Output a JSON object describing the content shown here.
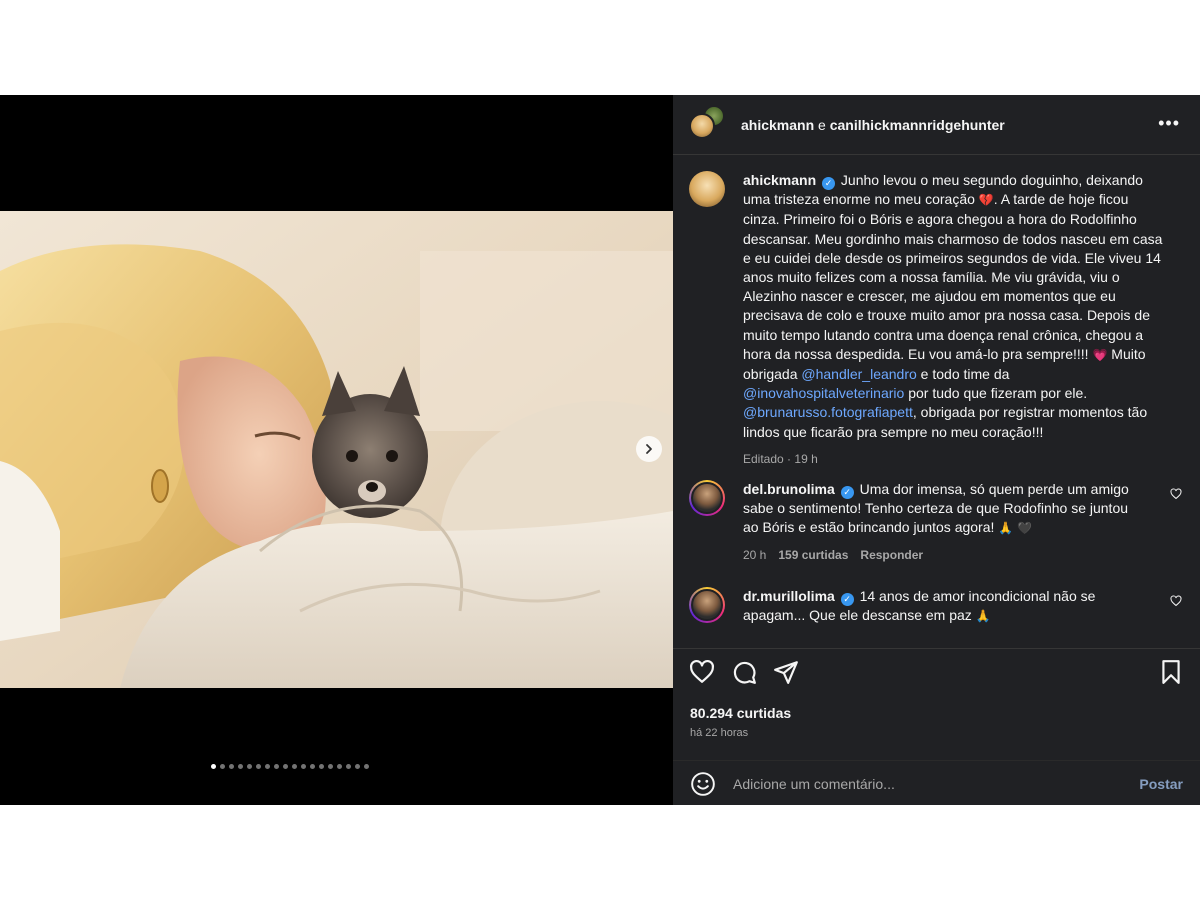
{
  "header": {
    "user1": "ahickmann",
    "conjunction": "e",
    "user2": "canilhickmannridgehunter",
    "more_label": "•••"
  },
  "caption": {
    "username": "ahickmann",
    "verified_mark": "✓",
    "part1": "Junho levou o meu segundo doguinho, deixando uma tristeza enorme no meu coração ",
    "emoji1": "💔",
    "part2": ". A tarde de hoje ficou cinza. Primeiro foi o Bóris e agora chegou a hora do Rodolfinho descansar. Meu gordinho mais charmoso de todos nasceu em casa e eu cuidei dele desde os primeiros segundos de vida. Ele viveu 14 anos muito felizes com a nossa família. Me viu grávida, viu o Alezinho nascer e crescer, me ajudou em momentos que eu precisava de colo e trouxe muito amor pra nossa casa. Depois de muito tempo lutando contra uma doença renal crônica, chegou a hora da nossa despedida. Eu vou amá-lo pra sempre!!!! ",
    "emoji2": "💗",
    "part3": " Muito obrigada ",
    "mention1": "@handler_leandro",
    "part4": " e todo time da ",
    "mention2": "@inovahospitalveterinario",
    "part5": " por tudo que fizeram por ele. ",
    "mention3": "@brunarusso.fotografiapett",
    "part6": ", obrigada por registrar momentos tão lindos que ficarão pra sempre no meu coração!!!",
    "edited": "Editado",
    "separator": "·",
    "time": "19 h"
  },
  "comments": [
    {
      "username": "del.brunolima",
      "text": "Uma dor imensa, só quem perde um amigo sabe o sentimento! Tenho certeza de que Rodofinho se juntou ao Bóris e estão brincando juntos agora! ",
      "emojis": "🙏 🖤",
      "time": "20 h",
      "likes": "159 curtidas",
      "reply": "Responder"
    },
    {
      "username": "dr.murillolima",
      "text": "14 anos de amor incondicional não se apagam... Que ele descanse em paz ",
      "emojis": "🙏"
    }
  ],
  "actions": {
    "likes_count": "80.294 curtidas",
    "posted_ago": "há 22 horas",
    "comment_placeholder": "Adicione um comentário...",
    "post_label": "Postar"
  },
  "carousel": {
    "slide_count": 18,
    "active_index": 0
  },
  "icons": {
    "like": "heart-icon",
    "comment": "comment-icon",
    "share": "share-icon",
    "save": "bookmark-icon",
    "emoji": "emoji-icon",
    "next": "chevron-right-icon"
  }
}
